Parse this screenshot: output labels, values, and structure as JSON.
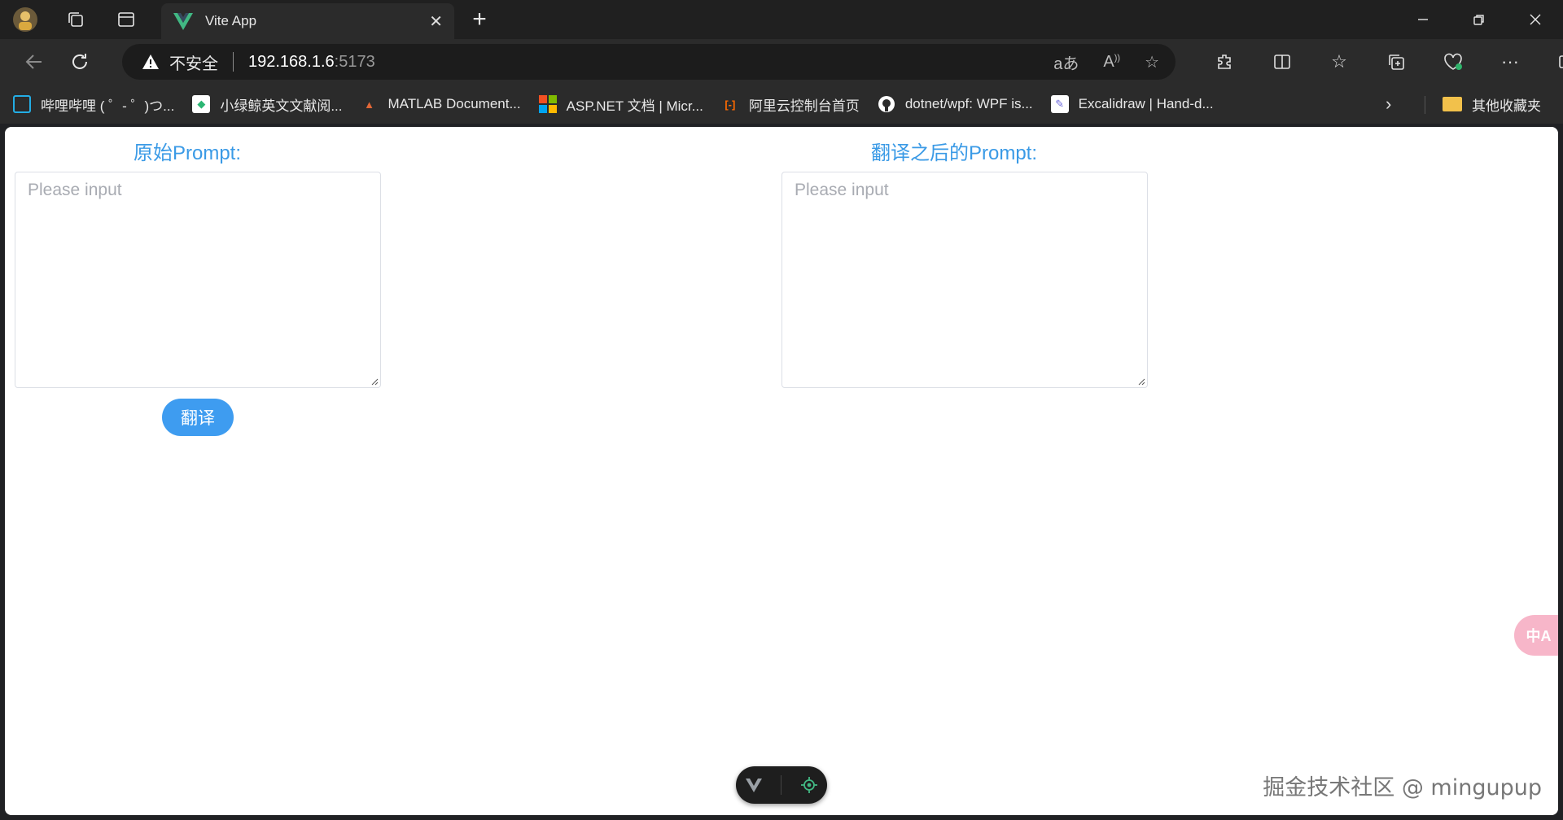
{
  "browser": {
    "tab_title": "Vite App",
    "address": {
      "security_label": "不安全",
      "host": "192.168.1.6",
      "port": ":5173"
    },
    "bookmarks": [
      {
        "label": "哔哩哔哩 ( ゜- ゜)つ...",
        "icon": "bilibili-icon",
        "color": "#23ade5"
      },
      {
        "label": "小绿鲸英文文献阅...",
        "icon": "green-whale-icon",
        "color": "#2bb673"
      },
      {
        "label": "MATLAB Document...",
        "icon": "matlab-icon",
        "color": "#e16737"
      },
      {
        "label": "ASP.NET 文档 | Micr...",
        "icon": "microsoft-icon",
        "color": "#f25022"
      },
      {
        "label": "阿里云控制台首页",
        "icon": "aliyun-icon",
        "color": "#ff6a00"
      },
      {
        "label": "dotnet/wpf: WPF is...",
        "icon": "github-icon",
        "color": "#ffffff"
      },
      {
        "label": "Excalidraw | Hand-d...",
        "icon": "excalidraw-icon",
        "color": "#6965db"
      }
    ],
    "other_bookmarks": "其他收藏夹"
  },
  "page": {
    "source_title": "原始Prompt:",
    "source_placeholder": "Please input",
    "translate_button": "翻译",
    "target_title": "翻译之后的Prompt:",
    "target_placeholder": "Please input",
    "float_label": "中A"
  },
  "watermark": "掘金技术社区 @ mingupup",
  "colors": {
    "accent": "#3a9ae6",
    "button": "#3e9cf0"
  }
}
